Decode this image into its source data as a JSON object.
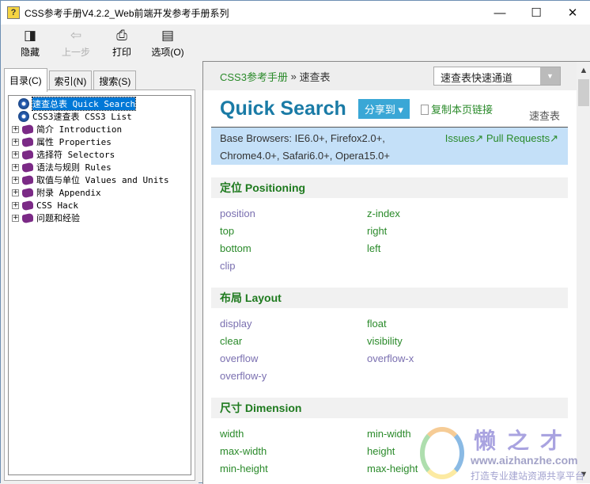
{
  "window": {
    "title": "CSS参考手册V4.2.2_Web前端开发参考手册系列",
    "minimize": "—",
    "maximize": "☐",
    "close": "✕"
  },
  "toolbar": [
    {
      "label": "隐藏",
      "icon": "hide-icon",
      "glyph": "◨"
    },
    {
      "label": "上一步",
      "icon": "back-icon",
      "glyph": "⇦"
    },
    {
      "label": "打印",
      "icon": "print-icon",
      "glyph": "⎙"
    },
    {
      "label": "选项(O)",
      "icon": "options-icon",
      "glyph": "▤"
    }
  ],
  "tabs": [
    "目录(C)",
    "索引(N)",
    "搜索(S)"
  ],
  "tree": [
    {
      "label": "速查总表 Quick Search",
      "type": "page",
      "selected": true
    },
    {
      "label": "CSS3速查表 CSS3 List",
      "type": "page"
    },
    {
      "label": "简介 Introduction",
      "type": "book"
    },
    {
      "label": "属性 Properties",
      "type": "book"
    },
    {
      "label": "选择符 Selectors",
      "type": "book"
    },
    {
      "label": "语法与规则 Rules",
      "type": "book"
    },
    {
      "label": "取值与单位 Values and Units",
      "type": "book"
    },
    {
      "label": "附录 Appendix",
      "type": "book"
    },
    {
      "label": "CSS Hack",
      "type": "book"
    },
    {
      "label": "问题和经验",
      "type": "book"
    }
  ],
  "breadcrumb": {
    "home": "CSS3参考手册",
    "sep": " » ",
    "current": "速查表"
  },
  "quick_select": {
    "value": "速查表快速通道",
    "arrow": "▼"
  },
  "page": {
    "title": "Quick Search",
    "share": "分享到 ▾",
    "copy_link": "复制本页链接",
    "tag": "速查表",
    "browsers_line1": "Base Browsers: IE6.0+, Firefox2.0+,",
    "browsers_line2": "Chrome4.0+, Safari6.0+, Opera15.0+",
    "issues": "Issues↗",
    "pull_requests": "Pull Requests↗"
  },
  "sections": [
    {
      "title": "定位 Positioning",
      "items": [
        {
          "t": "position",
          "v": true
        },
        {
          "t": "z-index"
        },
        {
          "t": "top"
        },
        {
          "t": "right"
        },
        {
          "t": "bottom"
        },
        {
          "t": "left"
        },
        {
          "t": "clip",
          "v": true
        }
      ]
    },
    {
      "title": "布局 Layout",
      "items": [
        {
          "t": "display",
          "v": true
        },
        {
          "t": "float"
        },
        {
          "t": "clear"
        },
        {
          "t": "visibility"
        },
        {
          "t": "overflow",
          "v": true
        },
        {
          "t": "overflow-x",
          "v": true
        },
        {
          "t": "overflow-y",
          "v": true
        }
      ]
    },
    {
      "title": "尺寸 Dimension",
      "items": [
        {
          "t": "width"
        },
        {
          "t": "min-width"
        },
        {
          "t": "max-width"
        },
        {
          "t": "height"
        },
        {
          "t": "min-height"
        },
        {
          "t": "max-height"
        }
      ]
    }
  ],
  "watermark": {
    "name": "懒之才",
    "url": "www.aizhanzhe.com",
    "slogan": "打造专业建站资源共享平台"
  }
}
